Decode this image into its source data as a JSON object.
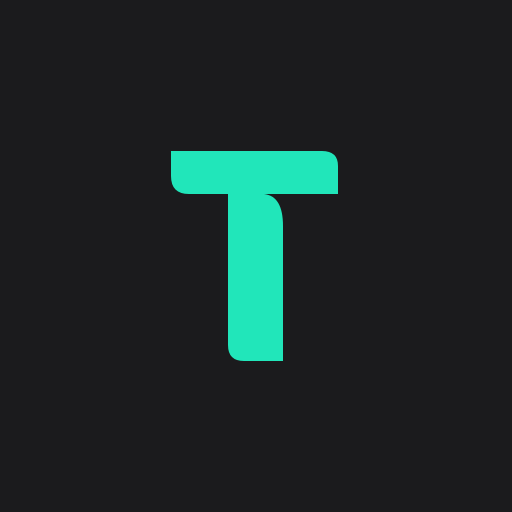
{
  "app_icon": {
    "icon_name": "t-letter-logo-icon",
    "colors": {
      "background": "#1b1b1d",
      "accent": "#21e6ba"
    }
  }
}
